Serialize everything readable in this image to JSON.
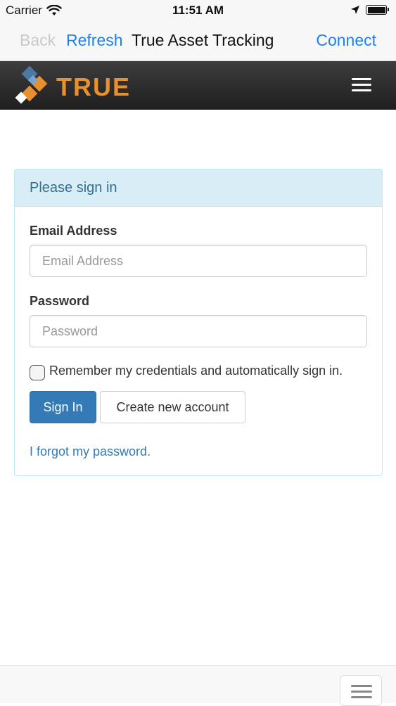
{
  "status_bar": {
    "carrier": "Carrier",
    "time": "11:51 AM",
    "icons": [
      "wifi-icon",
      "location-arrow-icon",
      "battery-icon"
    ]
  },
  "nav_bar": {
    "back_label": "Back",
    "refresh_label": "Refresh",
    "title": "True Asset Tracking",
    "connect_label": "Connect",
    "back_enabled": false
  },
  "brand": {
    "logo_text": "TRUE",
    "menu_icon": "hamburger-menu-icon",
    "colors": {
      "header_bg": "#2b2b2b",
      "logo_orange": "#e9902e",
      "logo_blue": "#4a79a5"
    }
  },
  "signin": {
    "panel_title": "Please sign in",
    "email_label": "Email Address",
    "email_value": "",
    "email_placeholder": "Email Address",
    "password_label": "Password",
    "password_value": "",
    "password_placeholder": "Password",
    "remember_label": "Remember my credentials and automatically sign in.",
    "remember_checked": false,
    "signin_button": "Sign In",
    "create_account_button": "Create new account",
    "forgot_link": "I forgot my password.",
    "colors": {
      "heading_bg": "#d9edf7",
      "heading_text": "#31708f",
      "primary_button": "#337ab7",
      "link": "#337ab7"
    }
  },
  "bottom_bar": {
    "menu_icon": "hamburger-menu-icon"
  }
}
